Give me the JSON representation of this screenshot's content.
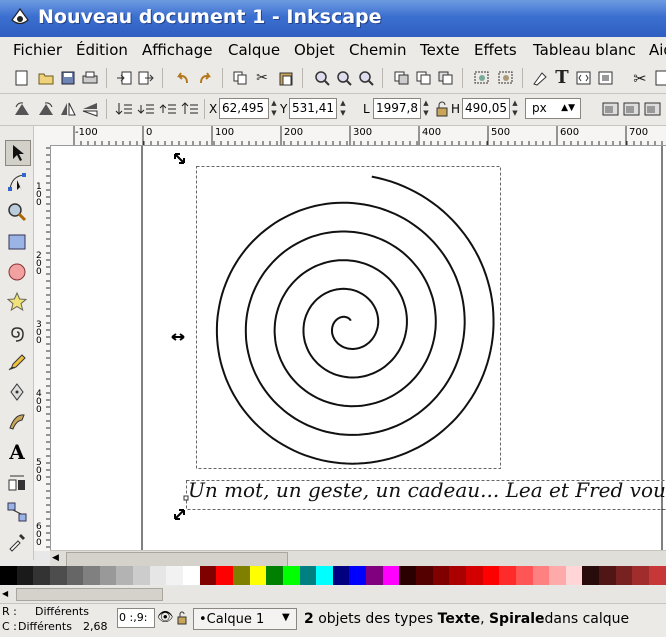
{
  "window": {
    "title": "Nouveau document 1 - Inkscape"
  },
  "menu": [
    "Fichier",
    "Édition",
    "Affichage",
    "Calque",
    "Objet",
    "Chemin",
    "Texte",
    "Effets",
    "Tableau blanc",
    "Aide"
  ],
  "controls": {
    "x_label": "X",
    "x_value": "62,495",
    "y_label": "Y",
    "y_value": "531,41",
    "w_label": "L",
    "w_value": "1997,8",
    "h_label": "H",
    "h_value": "490,05",
    "unit": "px"
  },
  "ruler": {
    "h_ticks": [
      "-100",
      "0",
      "100",
      "200",
      "300",
      "400",
      "500",
      "600",
      "700"
    ],
    "v_ticks": [
      "100",
      "200",
      "300",
      "400",
      "500",
      "600"
    ]
  },
  "canvas": {
    "text_object": "Un mot, un geste, un cadeau... Lea et Fred vous remercient"
  },
  "palette_colors": [
    "#000000",
    "#1a1a1a",
    "#333333",
    "#4d4d4d",
    "#666666",
    "#808080",
    "#999999",
    "#b3b3b3",
    "#cccccc",
    "#e6e6e6",
    "#f2f2f2",
    "#ffffff",
    "#800000",
    "#ff0000",
    "#808000",
    "#ffff00",
    "#008000",
    "#00ff00",
    "#008080",
    "#00ffff",
    "#000080",
    "#0000ff",
    "#800080",
    "#ff00ff",
    "#2b0000",
    "#550000",
    "#800000",
    "#aa0000",
    "#d40000",
    "#ff0000",
    "#ff2a2a",
    "#ff5555",
    "#ff8080",
    "#ffaaaa",
    "#ffd5d5",
    "#280b0b",
    "#501616",
    "#782121",
    "#a02c2c",
    "#c83737"
  ],
  "status": {
    "fill_label": "R :",
    "fill_value": "Différents",
    "stroke_label": "C :",
    "stroke_value": "Différents",
    "stroke_width": "2,68",
    "opacity": "0 :,9:",
    "layer": "•Calque 1",
    "message_prefix": "2",
    "message_mid1": " objets des types ",
    "message_bold1": "Texte",
    "message_sep": ", ",
    "message_bold2": "Spirale",
    "message_tail": "dans calque"
  }
}
